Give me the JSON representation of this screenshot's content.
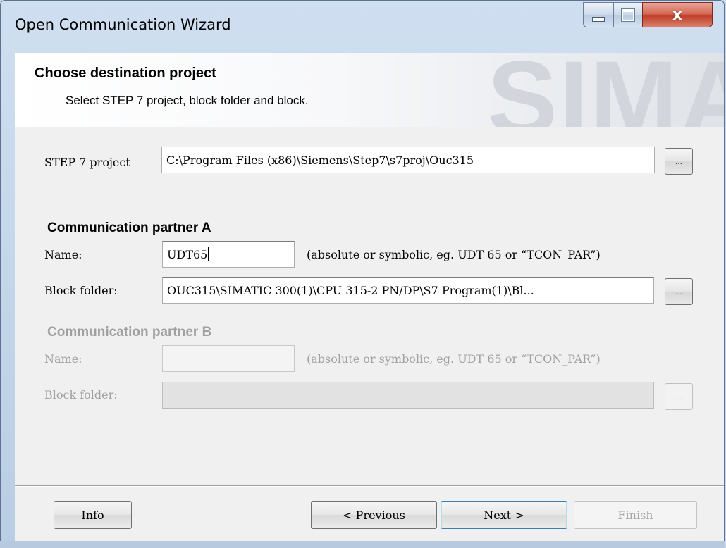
{
  "window": {
    "title": "Open Communication Wizard",
    "controls": {
      "minimize_icon": "minimize-icon",
      "maximize_icon": "maximize-icon",
      "close_glyph": "x"
    }
  },
  "header": {
    "title": "Choose destination project",
    "subtitle": "Select STEP 7 project, block folder and block.",
    "watermark": "SIMA"
  },
  "project": {
    "label": "STEP 7 project",
    "value": "C:\\Program Files (x86)\\Siemens\\Step7\\s7proj\\Ouc315",
    "browse_label": "..."
  },
  "partner_a": {
    "heading": "Communication partner A",
    "name_label": "Name:",
    "name_value": "UDT65",
    "name_hint": "(absolute or symbolic, eg. UDT 65 or “TCON_PAR”)",
    "folder_label": "Block folder:",
    "folder_value": "OUC315\\SIMATIC 300(1)\\CPU 315-2 PN/DP\\S7 Program(1)\\Bl...",
    "browse_label": "..."
  },
  "partner_b": {
    "heading": "Communication partner B",
    "name_label": "Name:",
    "name_value": "",
    "name_hint": "(absolute or symbolic, eg. UDT 65 or “TCON_PAR”)",
    "folder_label": "Block folder:",
    "folder_value": "",
    "browse_label": "..."
  },
  "footer": {
    "info_label": "Info",
    "previous_label": "< Previous",
    "next_label": "Next >",
    "finish_label": "Finish"
  }
}
